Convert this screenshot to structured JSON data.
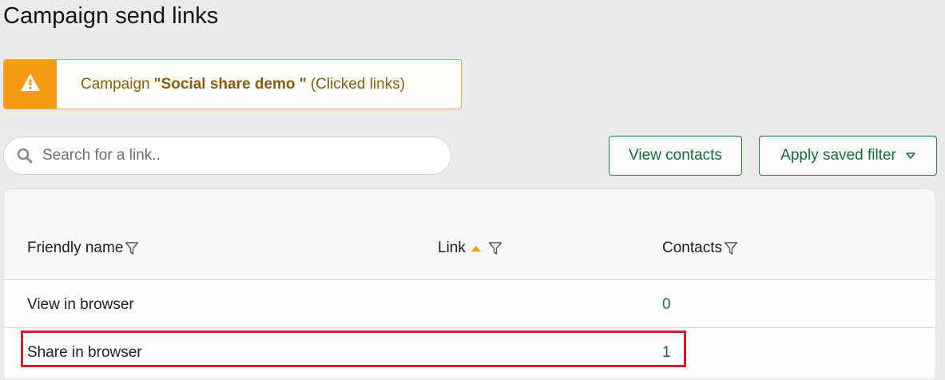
{
  "page": {
    "title": "Campaign send links"
  },
  "notice": {
    "prefix": "Campaign",
    "campaign_name": "\"Social share demo \"",
    "suffix": "(Clicked links)",
    "icon": "warning-icon"
  },
  "search": {
    "placeholder": "Search for a link..",
    "value": ""
  },
  "toolbar": {
    "view_contacts_label": "View contacts",
    "apply_filter_label": "Apply saved filter"
  },
  "table": {
    "columns": {
      "friendly_name": "Friendly name",
      "link": "Link",
      "contacts": "Contacts"
    },
    "sort": {
      "column": "link",
      "direction": "asc"
    },
    "rows": [
      {
        "friendly_name": "View in browser",
        "link": "",
        "contacts": "0"
      },
      {
        "friendly_name": "Share in browser",
        "link": "",
        "contacts": "1"
      }
    ],
    "highlighted_row": 1
  },
  "colors": {
    "accent_green": "#1e7a4a",
    "warning_orange": "#f59c12",
    "highlight_red": "#d3212b",
    "link_blue": "#1f5e7c"
  }
}
